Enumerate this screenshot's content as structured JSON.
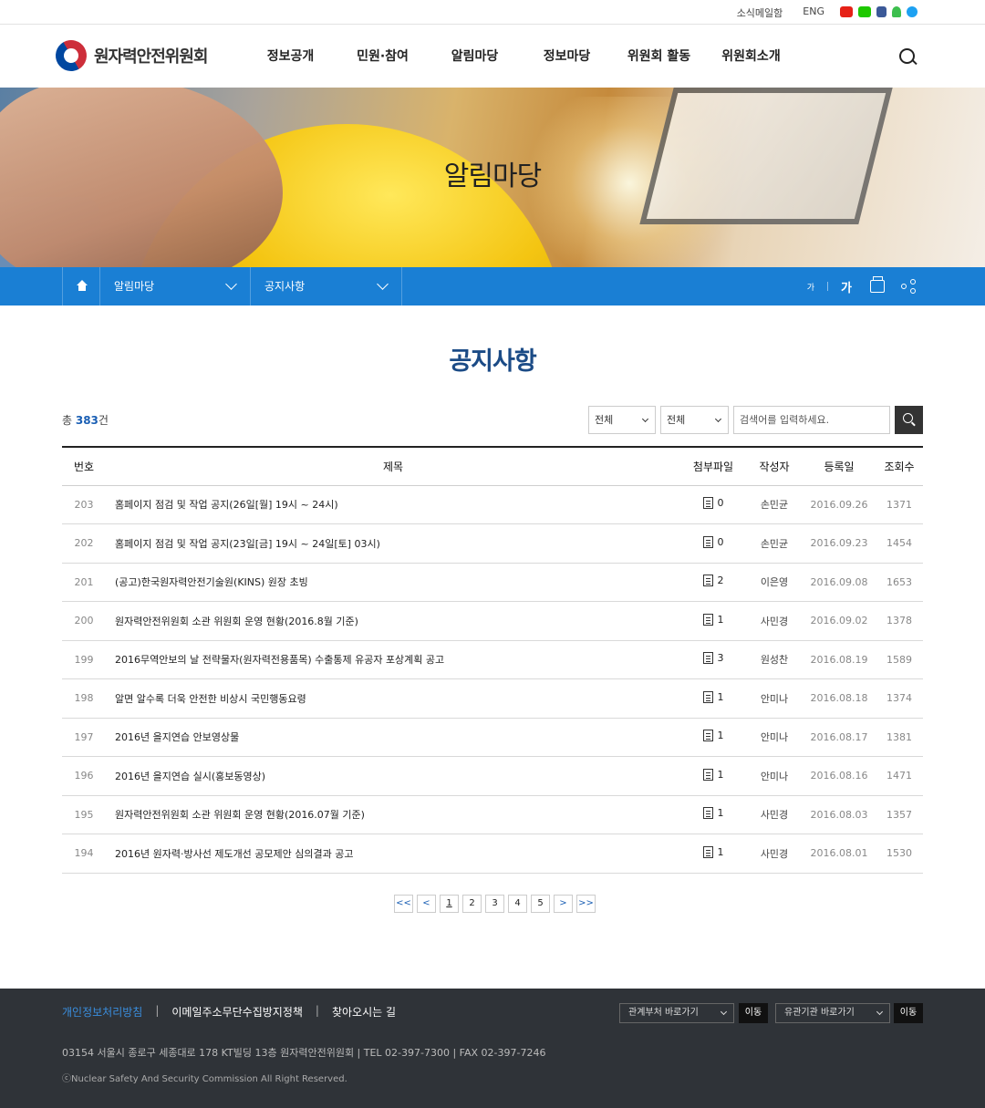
{
  "util": {
    "newsletter": "소식메일함",
    "english": "ENG",
    "sns": [
      "youtube-icon",
      "blog-icon",
      "facebook-icon",
      "kakaostory-icon",
      "twitter-icon"
    ]
  },
  "header": {
    "logo_text": "원자력안전위원회",
    "nav": [
      "정보공개",
      "민원·참여",
      "알림마당",
      "정보마당",
      "위원회 활동",
      "위원회소개"
    ]
  },
  "hero": {
    "title": "알림마당"
  },
  "location": {
    "depth1": "알림마당",
    "depth2": "공지사항",
    "font_small": "가",
    "font_large": "가"
  },
  "page": {
    "title": "공지사항"
  },
  "summary": {
    "prefix": "총 ",
    "count": "383",
    "suffix": "건"
  },
  "search": {
    "select1": "전체",
    "select2": "전체",
    "placeholder": "검색어를 입력하세요."
  },
  "table": {
    "headers": {
      "num": "번호",
      "title": "제목",
      "file": "첨부파일",
      "writer": "작성자",
      "date": "등록일",
      "views": "조회수"
    },
    "rows": [
      {
        "num": "203",
        "title": "홈페이지 점검 및 작업 공지(26일[월] 19시 ~ 24시)",
        "files": "0",
        "writer": "손민균",
        "date": "2016.09.26",
        "views": "1371"
      },
      {
        "num": "202",
        "title": "홈페이지 점검 및 작업 공지(23일[금] 19시 ~ 24일[토] 03시)",
        "files": "0",
        "writer": "손민균",
        "date": "2016.09.23",
        "views": "1454"
      },
      {
        "num": "201",
        "title": "(공고)한국원자력안전기술원(KINS) 원장 초빙",
        "files": "2",
        "writer": "이은영",
        "date": "2016.09.08",
        "views": "1653"
      },
      {
        "num": "200",
        "title": "원자력안전위원회 소관 위원회 운영 현황(2016.8월 기준)",
        "files": "1",
        "writer": "사민경",
        "date": "2016.09.02",
        "views": "1378"
      },
      {
        "num": "199",
        "title": "2016무역안보의 날 전략물자(원자력전용품목) 수출통제 유공자 포상계획 공고",
        "files": "3",
        "writer": "원성찬",
        "date": "2016.08.19",
        "views": "1589"
      },
      {
        "num": "198",
        "title": "알면 알수록 더욱 안전한 비상시 국민행동요령",
        "files": "1",
        "writer": "안미나",
        "date": "2016.08.18",
        "views": "1374"
      },
      {
        "num": "197",
        "title": "2016년 을지연습 안보영상물",
        "files": "1",
        "writer": "안미나",
        "date": "2016.08.17",
        "views": "1381"
      },
      {
        "num": "196",
        "title": "2016년 을지연습 실시(홍보동영상)",
        "files": "1",
        "writer": "안미나",
        "date": "2016.08.16",
        "views": "1471"
      },
      {
        "num": "195",
        "title": "원자력안전위원회 소관 위원회 운영 현황(2016.07월 기준)",
        "files": "1",
        "writer": "사민경",
        "date": "2016.08.03",
        "views": "1357"
      },
      {
        "num": "194",
        "title": "2016년 원자력·방사선 제도개선 공모제안 심의결과 공고",
        "files": "1",
        "writer": "사민경",
        "date": "2016.08.01",
        "views": "1530"
      }
    ]
  },
  "paging": {
    "first": "<<",
    "prev": "<",
    "pages": [
      "1",
      "2",
      "3",
      "4",
      "5"
    ],
    "current": "1",
    "next": ">",
    "last": ">>"
  },
  "footer": {
    "privacy": "개인정보처리방침",
    "email_policy": "이메일주소무단수집방지정책",
    "directions": "찾아오시는 길",
    "related_dept": "관계부처 바로가기",
    "related_org": "유관기관 바로가기",
    "go": "이동",
    "address": "03154 서울시 종로구 세종대로 178 KT빌딩 13층 원자력안전위원회   |   TEL 02-397-7300   |   FAX 02-397-7246",
    "copyright": "ⓒNuclear Safety And Security Commission All Right Reserved."
  },
  "colors": {
    "primary_blue": "#1a7fd4",
    "title_navy": "#1b4b86",
    "footer_bg": "#2f3338"
  }
}
